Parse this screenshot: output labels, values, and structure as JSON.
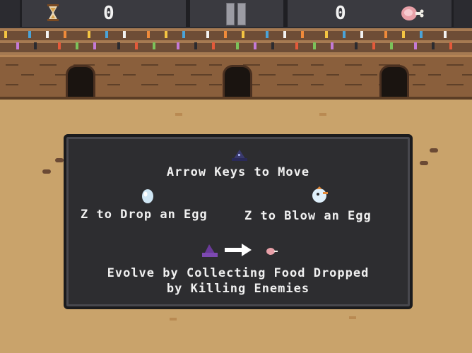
{
  "hud": {
    "timer_value": "0",
    "score_value": "0",
    "icons": [
      "hourglass-icon",
      "pause-icon",
      "meat-icon"
    ]
  },
  "instructions": {
    "move": "Arrow Keys to Move",
    "drop_egg": "Z to Drop an Egg",
    "blow_egg": "Z to Blow an Egg",
    "evolve_line1": "Evolve by Collecting Food Dropped",
    "evolve_line2": "by Killing Enemies"
  },
  "colors": {
    "sand": "#c9a36b",
    "wall": "#8a5f3c",
    "panel": "#2d2d30",
    "hud": "#2b2b30"
  }
}
